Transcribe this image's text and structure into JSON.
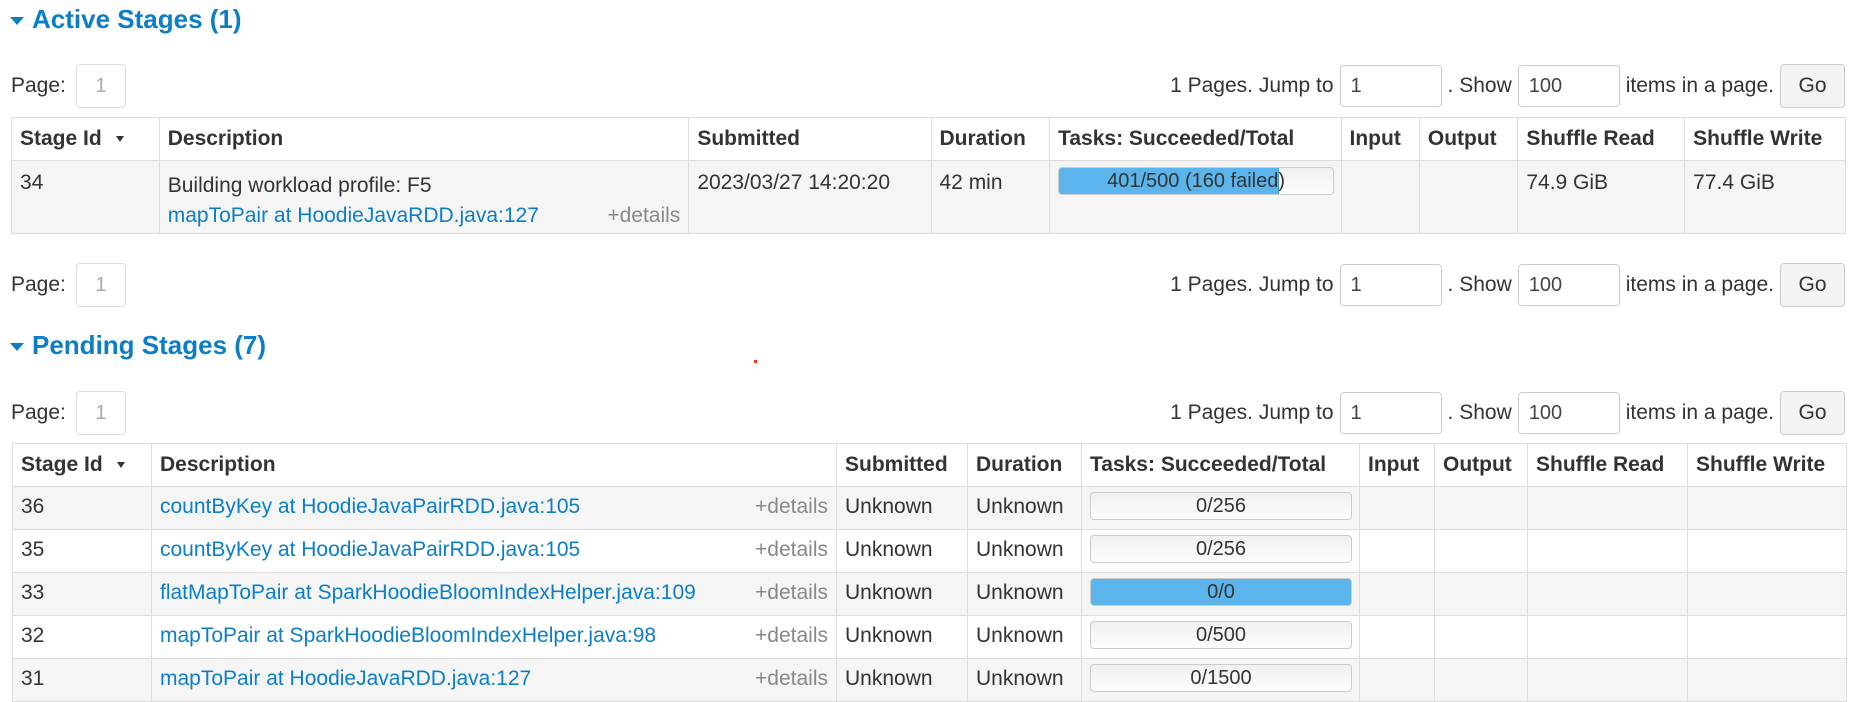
{
  "active": {
    "title": "Active Stages (1)",
    "page_label": "Page:",
    "page_current": "1",
    "pages_text": "1 Pages. Jump to",
    "jump_value": "1",
    "show_label": ". Show",
    "show_value": "100",
    "items_label": "items in a page.",
    "go_label": "Go",
    "columns": [
      "Stage Id",
      "Description",
      "Submitted",
      "Duration",
      "Tasks: Succeeded/Total",
      "Input",
      "Output",
      "Shuffle Read",
      "Shuffle Write"
    ],
    "rows": [
      {
        "stage_id": "34",
        "desc_line1": "Building workload profile: F5",
        "desc_link": "mapToPair at HoodieJavaRDD.java:127",
        "details": "+details",
        "submitted": "2023/03/27 14:20:20",
        "duration": "42 min",
        "tasks": "401/500 (160 failed)",
        "progress": 0.8,
        "input": "",
        "output": "",
        "shuffle_read": "74.9 GiB",
        "shuffle_write": "77.4 GiB"
      }
    ]
  },
  "active_bottom": {
    "page_label": "Page:",
    "page_current": "1",
    "pages_text": "1 Pages. Jump to",
    "jump_value": "1",
    "show_label": ". Show",
    "show_value": "100",
    "items_label": "items in a page.",
    "go_label": "Go"
  },
  "pending": {
    "title": "Pending Stages (7)",
    "page_label": "Page:",
    "page_current": "1",
    "pages_text": "1 Pages. Jump to",
    "jump_value": "1",
    "show_label": ". Show",
    "show_value": "100",
    "items_label": "items in a page.",
    "go_label": "Go",
    "columns": [
      "Stage Id",
      "Description",
      "Submitted",
      "Duration",
      "Tasks: Succeeded/Total",
      "Input",
      "Output",
      "Shuffle Read",
      "Shuffle Write"
    ],
    "rows": [
      {
        "stage_id": "36",
        "desc_link": "countByKey at HoodieJavaPairRDD.java:105",
        "details": "+details",
        "submitted": "Unknown",
        "duration": "Unknown",
        "tasks": "0/256",
        "progress": 0
      },
      {
        "stage_id": "35",
        "desc_link": "countByKey at HoodieJavaPairRDD.java:105",
        "details": "+details",
        "submitted": "Unknown",
        "duration": "Unknown",
        "tasks": "0/256",
        "progress": 0
      },
      {
        "stage_id": "33",
        "desc_link": "flatMapToPair at SparkHoodieBloomIndexHelper.java:109",
        "details": "+details",
        "submitted": "Unknown",
        "duration": "Unknown",
        "tasks": "0/0",
        "progress": 1
      },
      {
        "stage_id": "32",
        "desc_link": "mapToPair at SparkHoodieBloomIndexHelper.java:98",
        "details": "+details",
        "submitted": "Unknown",
        "duration": "Unknown",
        "tasks": "0/500",
        "progress": 0
      },
      {
        "stage_id": "31",
        "desc_link": "mapToPair at HoodieJavaRDD.java:127",
        "details": "+details",
        "submitted": "Unknown",
        "duration": "Unknown",
        "tasks": "0/1500",
        "progress": 0
      }
    ]
  },
  "colors": {
    "link": "#0c7ec6",
    "progress_fill": "#5bb5ec"
  }
}
